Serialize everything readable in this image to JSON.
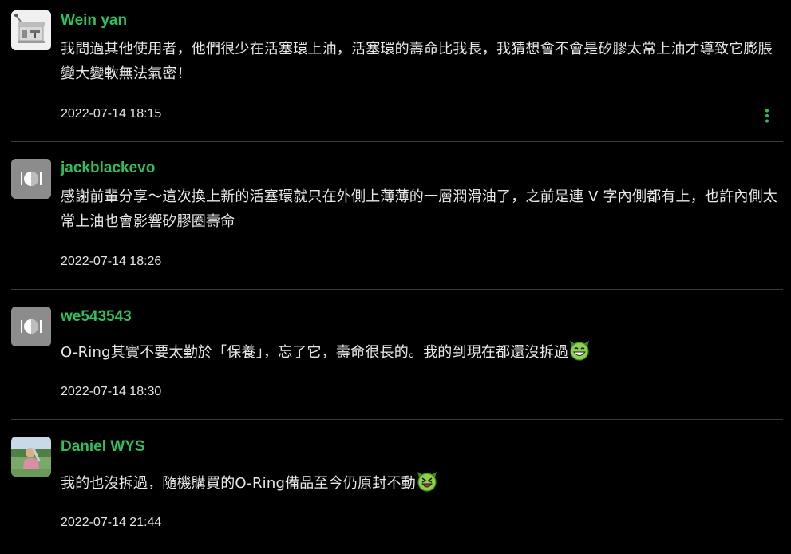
{
  "comments": [
    {
      "username": "Wein yan",
      "text": "我問過其他使用者，他們很少在活塞環上油，活塞環的壽命比我長，我猜想會不會是矽膠太常上油才導致它膨脹變大變軟無法氣密！",
      "timestamp": "2022-07-14 18:15",
      "avatar_icon": "espresso-machine-avatar",
      "has_menu": true
    },
    {
      "username": "jackblackevo",
      "text": "感謝前輩分享～這次換上新的活塞環就只在外側上薄薄的一層潤滑油了，之前是連 V 字內側都有上，也許內側太常上油也會影響矽膠圈壽命",
      "timestamp": "2022-07-14 18:26",
      "avatar_icon": "default-avatar-icon"
    },
    {
      "username": "we543543",
      "text": "O-Ring其實不要太勤於「保養」，忘了它，壽命很長的。我的到現在都還沒拆過",
      "timestamp": "2022-07-14 18:30",
      "avatar_icon": "default-avatar-icon",
      "emoji": "grinning-devil-emoji"
    },
    {
      "username": "Daniel WYS",
      "text": "我的也沒拆過，隨機購買的O-Ring備品至今仍原封不動",
      "timestamp": "2022-07-14 21:44",
      "avatar_icon": "photo-avatar",
      "emoji": "laughing-devil-emoji"
    }
  ],
  "colors": {
    "username": "#2fbf5f",
    "background": "#000000",
    "text": "#e8e8e8",
    "menu_dots": "#2fbf5f",
    "avatar_default_bg": "#8c8c8c"
  },
  "menu_icon": "more-vertical-icon"
}
